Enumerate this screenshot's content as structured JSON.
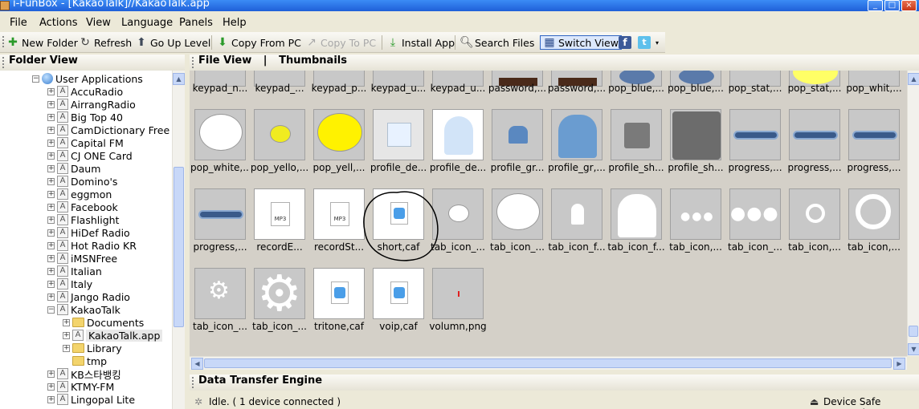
{
  "window": {
    "title": "i-FunBox - [KakaoTalk]//KakaoTalk.app"
  },
  "menu": [
    "File",
    "Actions",
    "View",
    "Language",
    "Panels",
    "Help"
  ],
  "toolbar": {
    "new_folder": "New Folder",
    "refresh": "Refresh",
    "go_up": "Go Up Level",
    "copy_from_pc": "Copy From PC",
    "copy_to_pc": "Copy To PC",
    "install_app": "Install App",
    "search_files": "Search Files",
    "switch_view": "Switch View"
  },
  "folder_view": {
    "title": "Folder View",
    "root": "User Applications",
    "apps": [
      "AccuRadio",
      "AirrangRadio",
      "Big Top 40",
      "CamDictionary Free",
      "Capital FM",
      "CJ ONE Card",
      "Daum",
      "Domino's",
      "eggmon",
      "Facebook",
      "Flashlight",
      "HiDef Radio",
      "Hot Radio KR",
      "iMSNFree",
      "Italian",
      "Italy",
      "Jango Radio",
      "KakaoTalk"
    ],
    "kakao_children": [
      "Documents",
      "KakaoTalk.app",
      "Library",
      "tmp"
    ],
    "apps_after": [
      "KB스타뱅킹",
      "KTMY-FM",
      "Lingopal Lite"
    ]
  },
  "file_view": {
    "title": "File View",
    "mode": "Thumbnails",
    "rows": [
      [
        "keypad_n...",
        "keypad_...",
        "keypad_p...",
        "keypad_u...",
        "keypad_u...",
        "password,...",
        "password,...",
        "pop_blue,...",
        "pop_blue,...",
        "pop_stat,...",
        "pop_stat,...",
        "pop_whit,..."
      ],
      [
        "pop_white,...",
        "pop_yello,...",
        "pop_yell,...",
        "profile_de...",
        "profile_de...",
        "profile_gr...",
        "profile_gr,...",
        "profile_sh...",
        "profile_sh...",
        "progress,...",
        "progress,...",
        "progress,..."
      ],
      [
        "progress,...",
        "recordE...",
        "recordSt...",
        "short,caf",
        "tab_icon_...",
        "tab_icon_...",
        "tab_icon_f...",
        "tab_icon_f...",
        "tab_icon,...",
        "tab_icon_...",
        "tab_icon,...",
        "tab_icon,..."
      ],
      [
        "tab_icon_...",
        "tab_icon_...",
        "tritone,caf",
        "voip,caf",
        "volumn,png"
      ]
    ]
  },
  "transfer": {
    "title": "Data Transfer Engine",
    "status": "Idle. ( 1 device connected )",
    "safe_removal": "Device Safe Removal"
  },
  "colors": {
    "titlebar": "#1f5fd8",
    "accent_green": "#2a9a2a",
    "selection": "#3166c4"
  }
}
